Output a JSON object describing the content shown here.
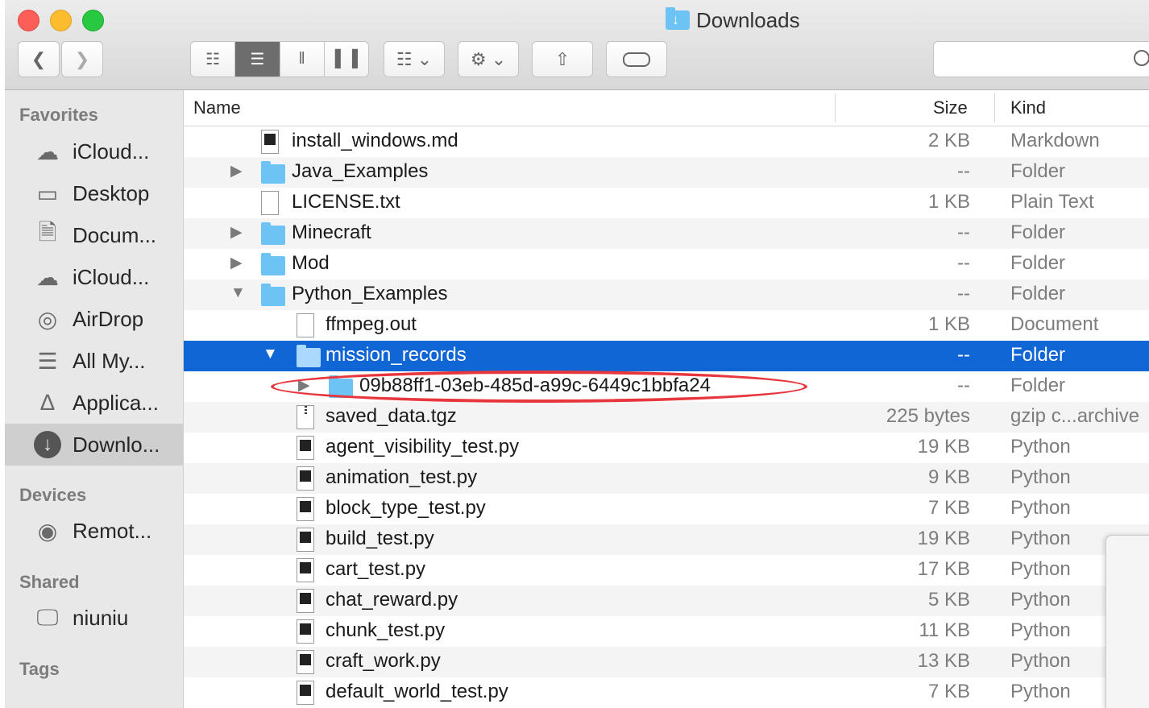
{
  "window": {
    "title": "Downloads"
  },
  "toolbar": {
    "back_icon": "chevron-left-icon",
    "forward_icon": "chevron-right-icon",
    "view_modes": [
      "icon-view",
      "list-view",
      "column-view",
      "cover-flow-view"
    ],
    "active_view": "list-view",
    "arrange_icon": "arrange-grid-icon",
    "action_icon": "gear-icon",
    "share_icon": "share-icon",
    "tag_icon": "tag-icon",
    "search_placeholder": ""
  },
  "sidebar": {
    "favorites_title": "Favorites",
    "favorites": [
      {
        "label": "iCloud...",
        "icon": "cloud-icon"
      },
      {
        "label": "Desktop",
        "icon": "desktop-icon"
      },
      {
        "label": "Docum...",
        "icon": "documents-icon"
      },
      {
        "label": "iCloud...",
        "icon": "cloud-icon"
      },
      {
        "label": "AirDrop",
        "icon": "airdrop-icon"
      },
      {
        "label": "All My...",
        "icon": "all-files-icon"
      },
      {
        "label": "Applica...",
        "icon": "applications-icon"
      },
      {
        "label": "Downlo...",
        "icon": "downloads-icon",
        "selected": true
      }
    ],
    "devices_title": "Devices",
    "devices": [
      {
        "label": "Remot...",
        "icon": "disc-icon"
      }
    ],
    "shared_title": "Shared",
    "shared": [
      {
        "label": "niuniu",
        "icon": "computer-icon"
      }
    ],
    "tags_title": "Tags"
  },
  "columns": {
    "name": "Name",
    "size": "Size",
    "kind": "Kind"
  },
  "files": [
    {
      "name": "install_windows.md",
      "size": "2 KB",
      "kind": "Markdown",
      "type": "doc",
      "level": 1,
      "disclosure": "none"
    },
    {
      "name": "Java_Examples",
      "size": "--",
      "kind": "Folder",
      "type": "folder",
      "level": 1,
      "disclosure": "collapsed"
    },
    {
      "name": "LICENSE.txt",
      "size": "1 KB",
      "kind": "Plain Text",
      "type": "text",
      "level": 1,
      "disclosure": "none"
    },
    {
      "name": "Minecraft",
      "size": "--",
      "kind": "Folder",
      "type": "folder",
      "level": 1,
      "disclosure": "collapsed"
    },
    {
      "name": "Mod",
      "size": "--",
      "kind": "Folder",
      "type": "folder",
      "level": 1,
      "disclosure": "collapsed"
    },
    {
      "name": "Python_Examples",
      "size": "--",
      "kind": "Folder",
      "type": "folder",
      "level": 1,
      "disclosure": "expanded"
    },
    {
      "name": "ffmpeg.out",
      "size": "1 KB",
      "kind": "Document",
      "type": "text",
      "level": 2,
      "disclosure": "none"
    },
    {
      "name": "mission_records",
      "size": "--",
      "kind": "Folder",
      "type": "folder",
      "level": 2,
      "disclosure": "expanded",
      "selected": true
    },
    {
      "name": "09b88ff1-03eb-485d-a99c-6449c1bbfa24",
      "size": "--",
      "kind": "Folder",
      "type": "folder",
      "level": 3,
      "disclosure": "collapsed",
      "highlighted": true
    },
    {
      "name": "saved_data.tgz",
      "size": "225 bytes",
      "kind": "gzip c...archive",
      "type": "zip",
      "level": 2,
      "disclosure": "none"
    },
    {
      "name": "agent_visibility_test.py",
      "size": "19 KB",
      "kind": "Python",
      "type": "python",
      "level": 2,
      "disclosure": "none"
    },
    {
      "name": "animation_test.py",
      "size": "9 KB",
      "kind": "Python",
      "type": "python",
      "level": 2,
      "disclosure": "none"
    },
    {
      "name": "block_type_test.py",
      "size": "7 KB",
      "kind": "Python",
      "type": "python",
      "level": 2,
      "disclosure": "none"
    },
    {
      "name": "build_test.py",
      "size": "19 KB",
      "kind": "Python",
      "type": "python",
      "level": 2,
      "disclosure": "none"
    },
    {
      "name": "cart_test.py",
      "size": "17 KB",
      "kind": "Python",
      "type": "python",
      "level": 2,
      "disclosure": "none"
    },
    {
      "name": "chat_reward.py",
      "size": "5 KB",
      "kind": "Python",
      "type": "python",
      "level": 2,
      "disclosure": "none"
    },
    {
      "name": "chunk_test.py",
      "size": "11 KB",
      "kind": "Python",
      "type": "python",
      "level": 2,
      "disclosure": "none"
    },
    {
      "name": "craft_work.py",
      "size": "13 KB",
      "kind": "Python",
      "type": "python",
      "level": 2,
      "disclosure": "none"
    },
    {
      "name": "default_world_test.py",
      "size": "7 KB",
      "kind": "Python",
      "type": "python",
      "level": 2,
      "disclosure": "none"
    }
  ],
  "colors": {
    "selection": "#1066d5",
    "highlight_ring": "#e8363d",
    "folder": "#6ec3f5"
  }
}
